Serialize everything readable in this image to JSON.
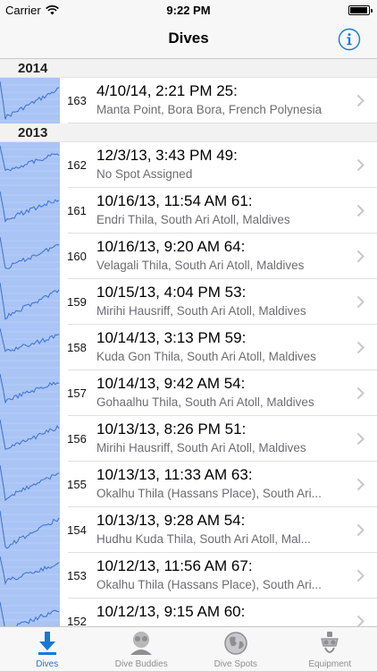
{
  "status_bar": {
    "carrier": "Carrier",
    "time": "9:22 PM"
  },
  "nav": {
    "title": "Dives"
  },
  "sections": [
    {
      "year": "2014",
      "dives": [
        {
          "number": "163",
          "title": "4/10/14, 2:21 PM 25:",
          "location": "Manta Point, Bora Bora, French Polynesia"
        }
      ]
    },
    {
      "year": "2013",
      "dives": [
        {
          "number": "162",
          "title": "12/3/13, 3:43 PM 49:",
          "location": "No Spot Assigned"
        },
        {
          "number": "161",
          "title": "10/16/13, 11:54 AM 61:",
          "location": "Endri Thila, South Ari Atoll, Maldives"
        },
        {
          "number": "160",
          "title": "10/16/13, 9:20 AM 64:",
          "location": "Velagali Thila, South Ari Atoll, Maldives"
        },
        {
          "number": "159",
          "title": "10/15/13, 4:04 PM 53:",
          "location": "Mirihi Hausriff, South Ari Atoll, Maldives"
        },
        {
          "number": "158",
          "title": "10/14/13, 3:13 PM 59:",
          "location": "Kuda Gon Thila, South Ari Atoll, Maldives"
        },
        {
          "number": "157",
          "title": "10/14/13, 9:42 AM 54:",
          "location": "Gohaalhu Thila, South Ari Atoll, Maldives"
        },
        {
          "number": "156",
          "title": "10/13/13, 8:26 PM 51:",
          "location": "Mirihi Hausriff, South Ari Atoll, Maldives"
        },
        {
          "number": "155",
          "title": "10/13/13, 11:33 AM 63:",
          "location": "Okalhu Thila (Hassans Place), South Ari..."
        },
        {
          "number": "154",
          "title": "10/13/13, 9:28 AM 54:",
          "location": "Hudhu Kuda Thila, South Ari Atoll, Mal..."
        },
        {
          "number": "153",
          "title": "10/12/13, 11:56 AM 67:",
          "location": "Okalhu Thila (Hassans Place), South Ari..."
        },
        {
          "number": "152",
          "title": "10/12/13, 9:15 AM 60:",
          "location": ""
        }
      ]
    }
  ],
  "tabs": [
    {
      "label": "Dives",
      "icon": "download-arrow-icon",
      "active": true
    },
    {
      "label": "Dive Buddies",
      "icon": "buddies-icon",
      "active": false
    },
    {
      "label": "Dive Spots",
      "icon": "globe-icon",
      "active": false
    },
    {
      "label": "Equipment",
      "icon": "dive-gear-icon",
      "active": false
    }
  ],
  "colors": {
    "accent": "#1878d6",
    "thumb_bg": "#a9c4f5",
    "profile_line": "#3a6fd0",
    "subtitle": "#6d6d72"
  }
}
